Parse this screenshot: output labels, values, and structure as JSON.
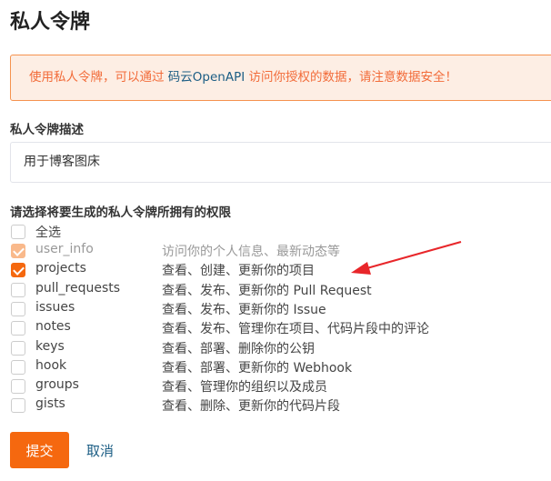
{
  "title": "私人令牌",
  "alert": {
    "before": "使用私人令牌，可以通过 ",
    "link": "码云OpenAPI",
    "after": " 访问你授权的数据，请注意数据安全！"
  },
  "description": {
    "label": "私人令牌描述",
    "value": "用于博客图床"
  },
  "permissions": {
    "label": "请选择将要生成的私人令牌所拥有的权限",
    "select_all": "全选",
    "items": [
      {
        "name": "user_info",
        "desc": "访问你的个人信息、最新动态等",
        "checked": true,
        "disabled": true
      },
      {
        "name": "projects",
        "desc": "查看、创建、更新你的项目",
        "checked": true,
        "disabled": false
      },
      {
        "name": "pull_requests",
        "desc": "查看、发布、更新你的 Pull Request",
        "checked": false
      },
      {
        "name": "issues",
        "desc": "查看、发布、更新你的 Issue",
        "checked": false
      },
      {
        "name": "notes",
        "desc": "查看、发布、管理你在项目、代码片段中的评论",
        "checked": false
      },
      {
        "name": "keys",
        "desc": "查看、部署、删除你的公钥",
        "checked": false
      },
      {
        "name": "hook",
        "desc": "查看、部署、更新你的 Webhook",
        "checked": false
      },
      {
        "name": "groups",
        "desc": "查看、管理你的组织以及成员",
        "checked": false
      },
      {
        "name": "gists",
        "desc": "查看、删除、更新你的代码片段",
        "checked": false
      }
    ]
  },
  "actions": {
    "submit": "提交",
    "cancel": "取消"
  },
  "colors": {
    "accent": "#f5680f",
    "link": "#1b5d84",
    "arrow": "#e8262a"
  }
}
